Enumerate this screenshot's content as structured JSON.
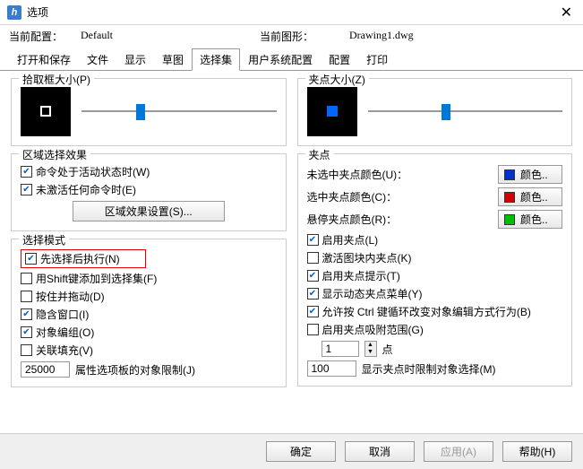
{
  "window": {
    "title": "选项"
  },
  "config": {
    "current_label": "当前配置：",
    "current_value": "Default",
    "drawing_label": "当前图形：",
    "drawing_value": "Drawing1.dwg"
  },
  "tabs": [
    "打开和保存",
    "文件",
    "显示",
    "草图",
    "选择集",
    "用户系统配置",
    "配置",
    "打印"
  ],
  "left": {
    "pickbox_title": "拾取框大小(P)",
    "region_title": "区域选择效果",
    "region_chk1": "命令处于活动状态时(W)",
    "region_chk2": "未激活任何命令时(E)",
    "region_btn": "区域效果设置(S)...",
    "mode_title": "选择模式",
    "mode_chk1": "先选择后执行(N)",
    "mode_chk2": "用Shift键添加到选择集(F)",
    "mode_chk3": "按住并拖动(D)",
    "mode_chk4": "隐含窗口(I)",
    "mode_chk5": "对象编组(O)",
    "mode_chk6": "关联填充(V)",
    "mode_num": "25000",
    "mode_num_label": "属性选项板的对象限制(J)"
  },
  "right": {
    "gripsize_title": "夹点大小(Z)",
    "grip_title": "夹点",
    "color1_label": "未选中夹点颜色(U)：",
    "color2_label": "选中夹点颜色(C)：",
    "color3_label": "悬停夹点颜色(R)：",
    "color_btn": "颜色..",
    "colors": {
      "unsel": "#0033cc",
      "sel": "#d40000",
      "hover": "#00c000"
    },
    "chk1": "启用夹点(L)",
    "chk2": "激活图块内夹点(K)",
    "chk3": "启用夹点提示(T)",
    "chk4": "显示动态夹点菜单(Y)",
    "chk5": "允许按 Ctrl 键循环改变对象编辑方式行为(B)",
    "chk6": "启用夹点吸附范围(G)",
    "num1": "1",
    "num1_suffix": "点",
    "num2": "100",
    "num2_label": "显示夹点时限制对象选择(M)"
  },
  "footer": {
    "ok": "确定",
    "cancel": "取消",
    "apply": "应用(A)",
    "help": "帮助(H)"
  }
}
